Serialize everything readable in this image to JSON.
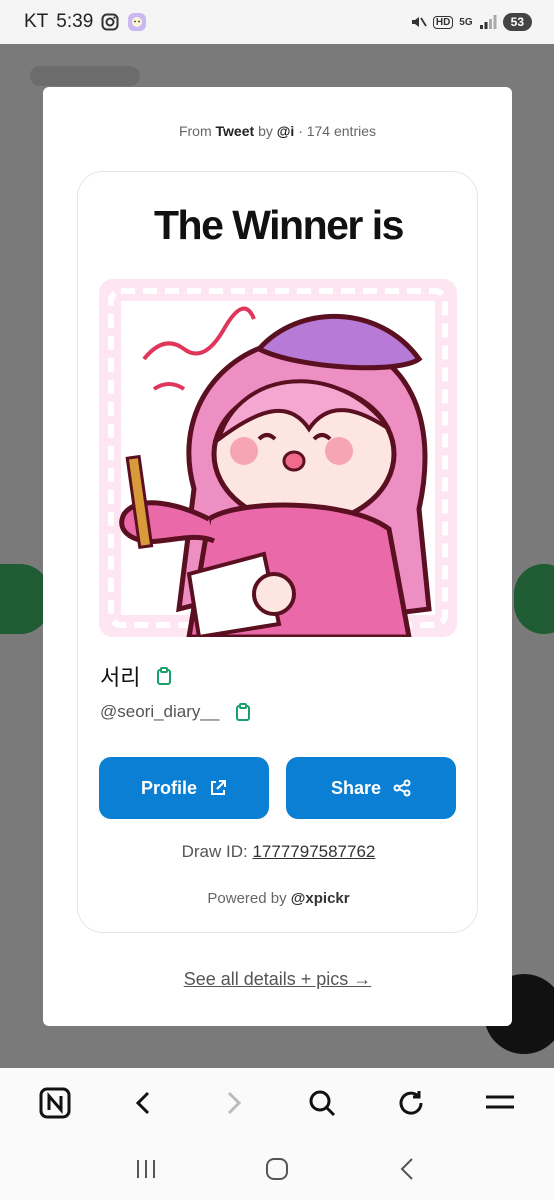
{
  "status_bar": {
    "carrier": "KT",
    "time": "5:39",
    "network_badge": "HD",
    "network_type": "5G",
    "battery": "53"
  },
  "modal": {
    "source": {
      "prefix": "From",
      "platform": "Tweet",
      "by_label": "by",
      "author": "@i",
      "entries": "· 174 entries"
    },
    "card": {
      "title": "The Winner is",
      "winner_name": "서리",
      "winner_handle": "@seori_diary__",
      "profile_button": "Profile",
      "share_button": "Share",
      "draw_id_label": "Draw ID:",
      "draw_id_value": "1777797587762",
      "powered_prefix": "Powered by",
      "powered_brand": "@xpickr"
    },
    "details_link": "See all details + pics →"
  },
  "colors": {
    "primary_button": "#0a7fd4",
    "copy_icon": "#1aa06a",
    "overlay": "#7a7a7a"
  },
  "icons": {
    "profile_button_icon": "external-link-icon",
    "share_button_icon": "share-icon",
    "copy_icon": "clipboard-icon",
    "toolbar": [
      "naver-home-icon",
      "back-arrow-icon",
      "forward-arrow-icon",
      "search-icon",
      "refresh-icon",
      "menu-icon"
    ],
    "system_nav": [
      "recent-apps-icon",
      "home-icon",
      "back-icon"
    ]
  }
}
